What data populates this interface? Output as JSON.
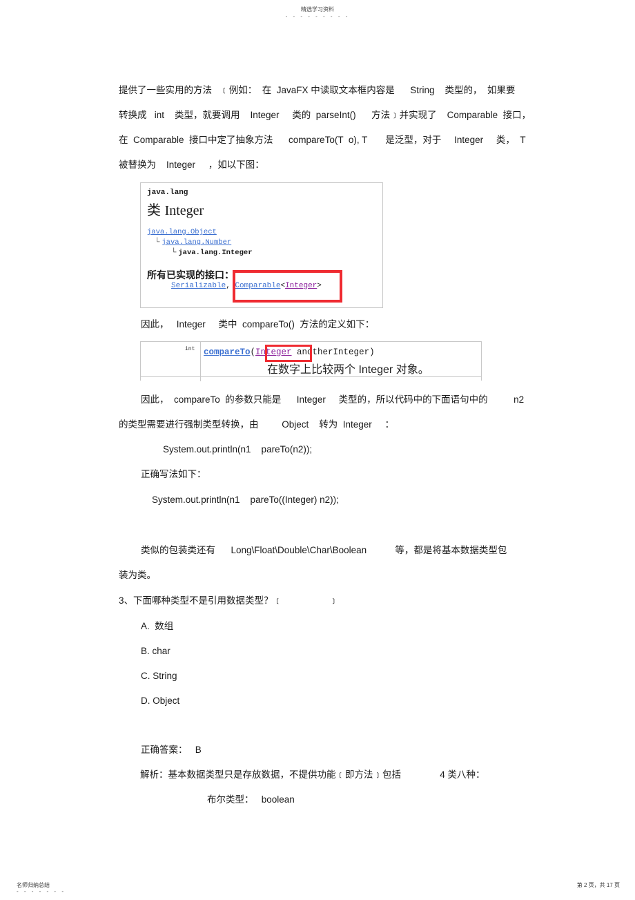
{
  "header": {
    "title": "精选学习资料",
    "dots": "- - - - - - - - -"
  },
  "paragraphs": {
    "p1": [
      "提供了一些实用的方法   ﹝例如：  在  JavaFX 中读取文本框内容是      String    类型的，  如果要",
      "转换成   int    类型，就要调用    Integer     类的  parseInt()      方法﹞并实现了    Comparable  接口，",
      "在  Comparable  接口中定了抽象方法      compareTo(T  o), T       是泛型，对于     Integer     类，  T",
      "被替换为    Integer     ，如以下图："
    ],
    "p2": "因此，   Integer     类中  compareTo()  方法的定义如下：",
    "p3": [
      "因此，  compareTo  的参数只能是      Integer     类型的，所以代码中的下面语句中的          n2",
      "的类型需要进行强制类型转换，由         Object    转为  Integer     ："
    ],
    "code1": "System.out.println(n1    pareTo(n2));",
    "p4": "正确写法如下：",
    "code2": "System.out.println(n1    pareTo((Integer) n2));",
    "p5": [
      "类似的包装类还有      Long\\Float\\Double\\Char\\Boolean           等，都是将基本数据类型包",
      "装为类。"
    ]
  },
  "javadoc_image1": {
    "package": "java.lang",
    "class_prefix": "类",
    "class_name": "Integer",
    "hierarchy": [
      "java.lang.Object",
      "java.lang.Number",
      "java.lang.Integer"
    ],
    "tree_branch": "└",
    "interfaces_label": "所有已实现的接口：",
    "interfaces": [
      "Serializable",
      "Comparable",
      "Integer"
    ],
    "comma": ",",
    "lt": "<",
    "gt": ">"
  },
  "javadoc_image2": {
    "return_type": "int",
    "method_name": "compareTo",
    "open_paren": "(",
    "param_type": "Integer",
    "param_rest": " anotherInteger)",
    "description": "在数字上比较两个 Integer 对象。"
  },
  "question": {
    "title": "3、下面哪种类型不是引用数据类型？﹝                  ﹞",
    "options": [
      "A.  数组",
      "B. char",
      "C. String",
      "D. Object"
    ],
    "answer": "正确答案：   B",
    "analysis": "解析：基本数据类型只是存放数据，不提供功能﹝即方法﹞包括               4 类八种：",
    "detail": "布尔类型：   boolean"
  },
  "footer": {
    "left": "名师归纳总结",
    "left_dots": "- - - - - - -",
    "right": "第 2 页，共 17 页"
  },
  "colors": {
    "highlight_red": "#ef2b31",
    "link_blue": "#3b6fd0",
    "link_purple": "#8a1f9b"
  }
}
